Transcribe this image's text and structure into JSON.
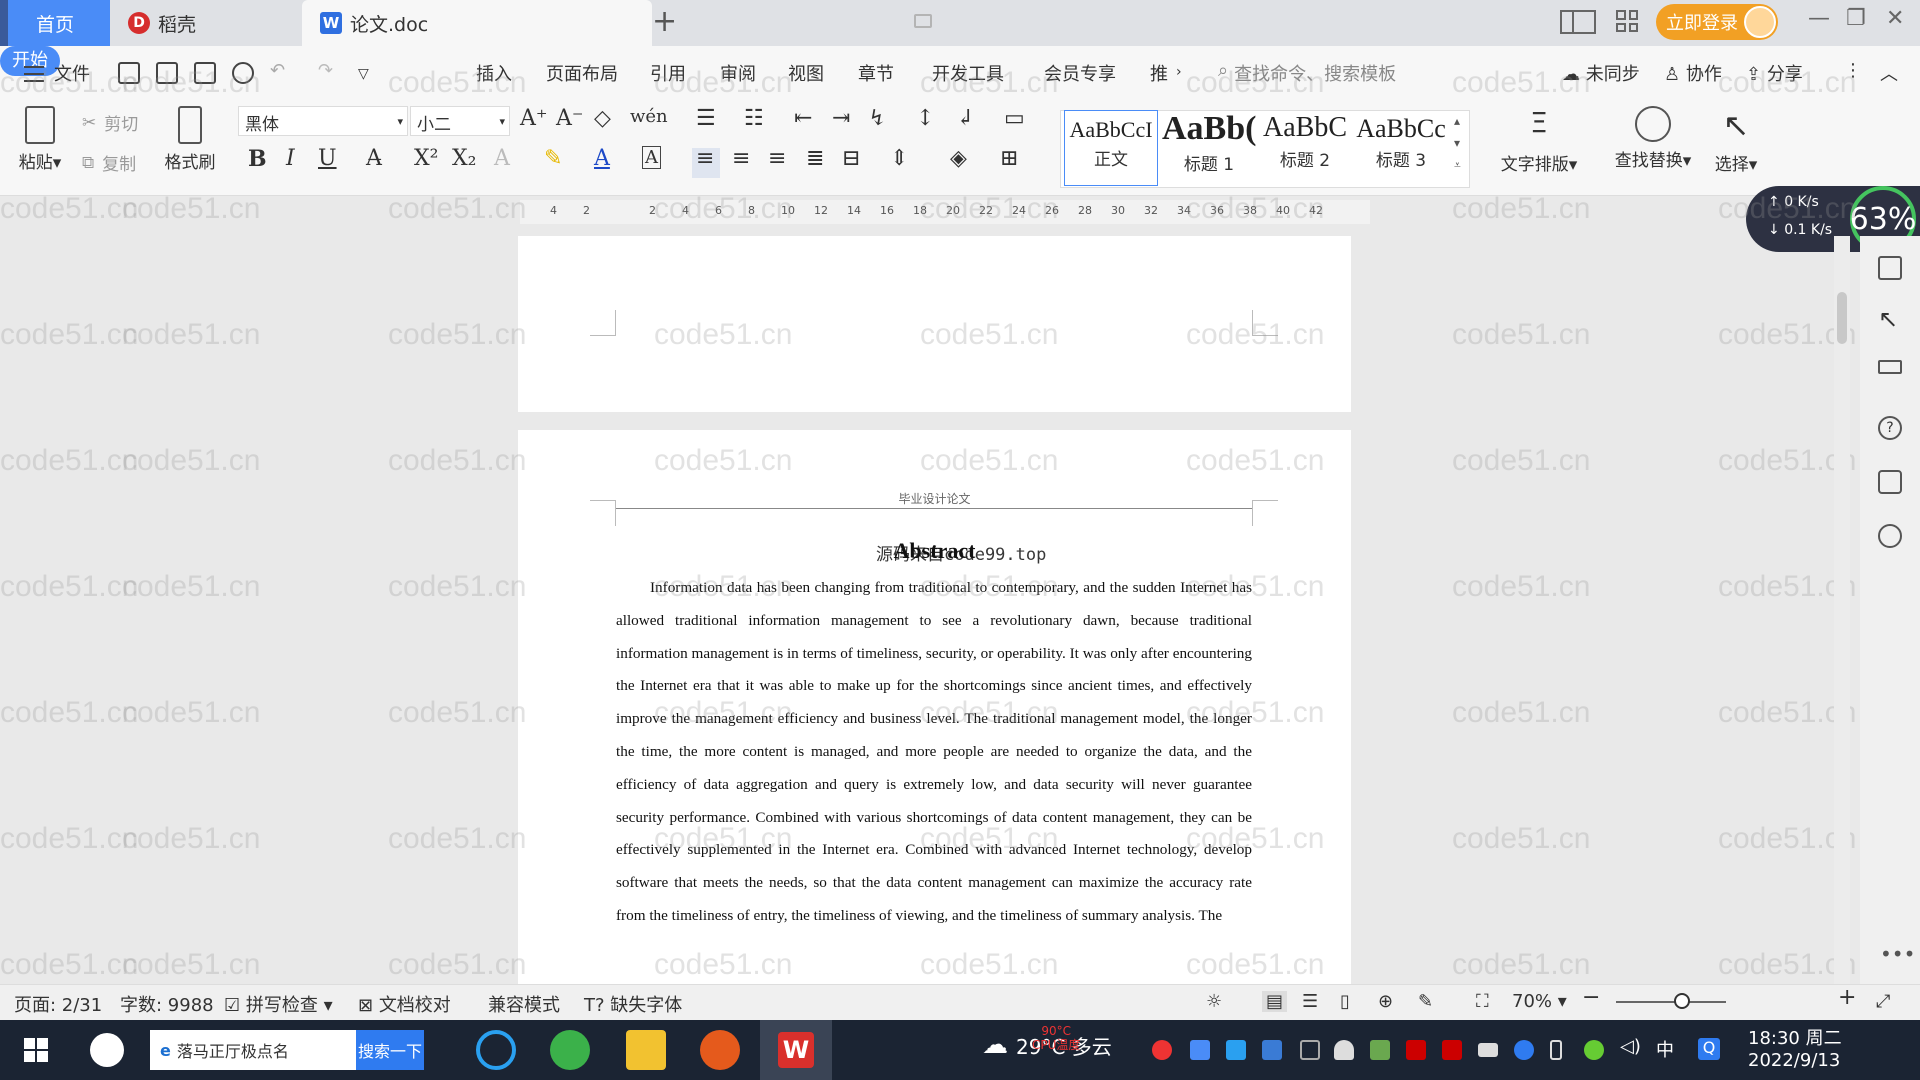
{
  "tabs": {
    "home": "首页",
    "daoke": "稻壳",
    "doc": "论文.doc",
    "doc_icon": "W",
    "login": "立即登录"
  },
  "menu": {
    "file": "文件",
    "items": [
      "开始",
      "插入",
      "页面布局",
      "引用",
      "审阅",
      "视图",
      "章节",
      "开发工具",
      "会员专享",
      "推"
    ],
    "search_cmd": "查找命令、搜索模板",
    "right": [
      "未同步",
      "协作",
      "分享"
    ]
  },
  "ribbon": {
    "paste": "粘贴",
    "cut": "剪切",
    "copy": "复制",
    "format_painter": "格式刷",
    "font": "黑体",
    "size": "小二",
    "styles": [
      {
        "sample": "AaBbCcI",
        "name": "正文"
      },
      {
        "sample": "AaBb(",
        "name": "标题 1"
      },
      {
        "sample": "AaBbC",
        "name": "标题 2"
      },
      {
        "sample": "AaBbCc",
        "name": "标题 3"
      }
    ],
    "text_layout": "文字排版",
    "find_replace": "查找替换",
    "select": "选择"
  },
  "ruler": [
    "4",
    "2",
    "",
    "2",
    "4",
    "6",
    "8",
    "10",
    "12",
    "14",
    "16",
    "18",
    "20",
    "22",
    "24",
    "26",
    "28",
    "30",
    "32",
    "34",
    "36",
    "38",
    "40",
    "42"
  ],
  "document": {
    "header": "毕业设计论文",
    "title": "Abstract",
    "stamp": "源码来自code99.top",
    "body": "Information data has been changing from traditional to contemporary, and the sudden Internet has allowed traditional information management to see a revolutionary dawn, because traditional information management is in terms of timeliness, security, or operability. It was only after encountering the Internet era that it was able to make up for the shortcomings since ancient times, and effectively improve the management efficiency and business level. The traditional management model, the longer the time, the more content is managed, and more people are needed to organize the data, and the efficiency of data aggregation and query is extremely low, and data security will never guarantee security performance. Combined with various shortcomings of data content management, they can be effectively supplemented in the Internet era. Combined with advanced Internet technology, develop software that meets the needs, so that the data content management can maximize the accuracy rate from the timeliness of entry, the timeliness of viewing, and the timeliness of summary analysis. The"
  },
  "watermark": "code51.cn",
  "speed": {
    "up": "0 K/s",
    "down": "0.1 K/s",
    "pct": "63%"
  },
  "status": {
    "page": "页面: 2/31",
    "words": "字数: 9988",
    "spell": "拼写检查",
    "proof": "文档校对",
    "compat": "兼容模式",
    "missing_font": "缺失字体",
    "zoom": "70%"
  },
  "taskbar": {
    "search_text": "落马正厅极点名",
    "search_btn": "搜索一下",
    "weather": "29°C 多云",
    "cpu": "90°C\nCPU温度",
    "ime": "中",
    "time": "18:30 周二",
    "date": "2022/9/13"
  }
}
